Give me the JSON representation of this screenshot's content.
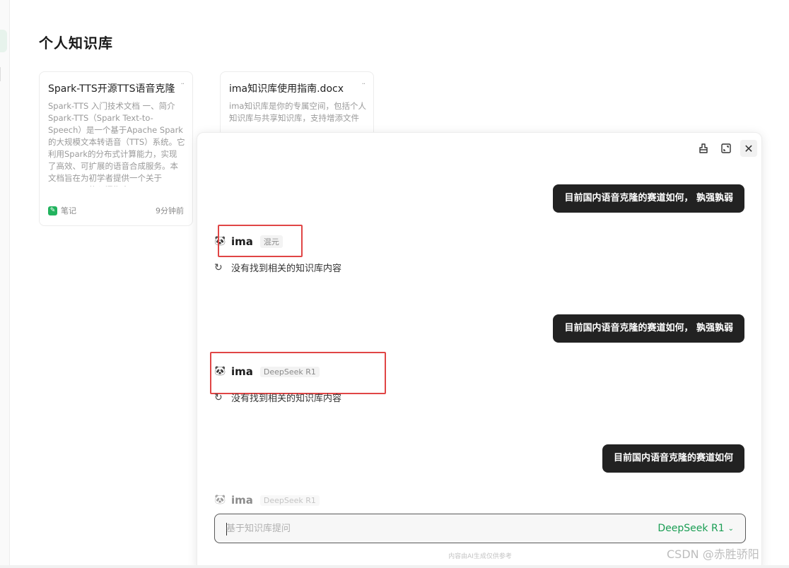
{
  "page": {
    "title": "个人知识库"
  },
  "cards": [
    {
      "title": "Spark-TTS开源TTS语音克隆",
      "more": "··",
      "body": "Spark-TTS 入门技术文档 一、简介 Spark-TTS（Spark Text-to-Speech）是一个基于Apache Spark的大规模文本转语音（TTS）系统。它利用Spark的分布式计算能力，实现了高效、可扩展的语音合成服务。本文档旨在为初学者提供一个关于Spark-TTS的入门指南",
      "type_label": "笔记",
      "type_icon": "note-icon",
      "time": "9分钟前"
    },
    {
      "title": "ima知识库使用指南.docx",
      "more": "··",
      "body": "ima知识库是你的专属空间，包括个人知识库与共享知识库，支持增添文件"
    }
  ],
  "chat": {
    "toolbar": {
      "clean_icon": "clean-icon",
      "expand_icon": "expand-icon",
      "close_icon": "close-icon"
    },
    "messages": [
      {
        "role": "user",
        "text": "目前国内语音克隆的赛道如何， 孰强孰弱"
      },
      {
        "role": "bot",
        "name": "ima",
        "model": "混元",
        "text": "没有找到相关的知识库内容"
      },
      {
        "role": "user",
        "text": "目前国内语音克隆的赛道如何， 孰强孰弱"
      },
      {
        "role": "bot",
        "name": "ima",
        "model": "DeepSeek R1",
        "text": "没有找到相关的知识库内容"
      },
      {
        "role": "user",
        "text": "目前国内语音克隆的赛道如何"
      },
      {
        "role": "bot",
        "name": "ima",
        "model": "DeepSeek R1"
      }
    ],
    "input": {
      "placeholder": "基于知识库提问",
      "value": ""
    },
    "model_selector": {
      "label": "DeepSeek R1"
    },
    "disclaimer": "内容由AI生成仅供参考"
  },
  "watermark": "CSDN @赤胜骄阳",
  "colors": {
    "accent": "#1a9e54",
    "user_bubble": "#222222",
    "highlight": "#e04545"
  }
}
